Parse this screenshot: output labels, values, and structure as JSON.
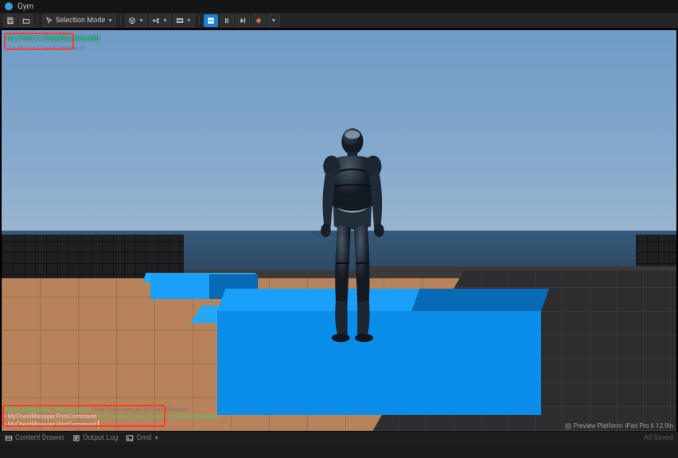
{
  "titlebar": {
    "title": "Gym"
  },
  "toolbar": {
    "save_tooltip": "Save",
    "browse_tooltip": "Browse",
    "mode_label": "Selection Mode",
    "add_label": "",
    "settings_label": "",
    "play_tooltip": "Play",
    "pause_tooltip": "Pause",
    "frameadvance_tooltip": "Frame Advance",
    "stop_tooltip": "Stop"
  },
  "viewport": {
    "print_string": "It's Print a CheatCommand!",
    "print_string_shadow": "It's Print a CheatCommand!",
    "actor_label": "MyCheatManager",
    "preview_platform": "Preview Platform: iPad Pro 6 12.9in"
  },
  "console": {
    "l1_cmd": "MyCheatManager.TestCommand",
    "l1_desc": "Test Command in MyCheatManager",
    "l2_cmd": "MyCheatManager.PrintCommand",
    "l2_tail": "Print a extra string from the MyCheatManager",
    "l3_cmd": "MyCheatManager.PrintCommand"
  },
  "statusbar": {
    "content_drawer": "Content Drawer",
    "output_log": "Output Log",
    "cmd_label": "Cmd",
    "revision": "All Saved"
  },
  "colors": {
    "accent_blue": "#1d7fd4",
    "platform_blue": "#1aa0f8",
    "print_green": "#12e85a",
    "callout_red": "#ff3a2f"
  }
}
